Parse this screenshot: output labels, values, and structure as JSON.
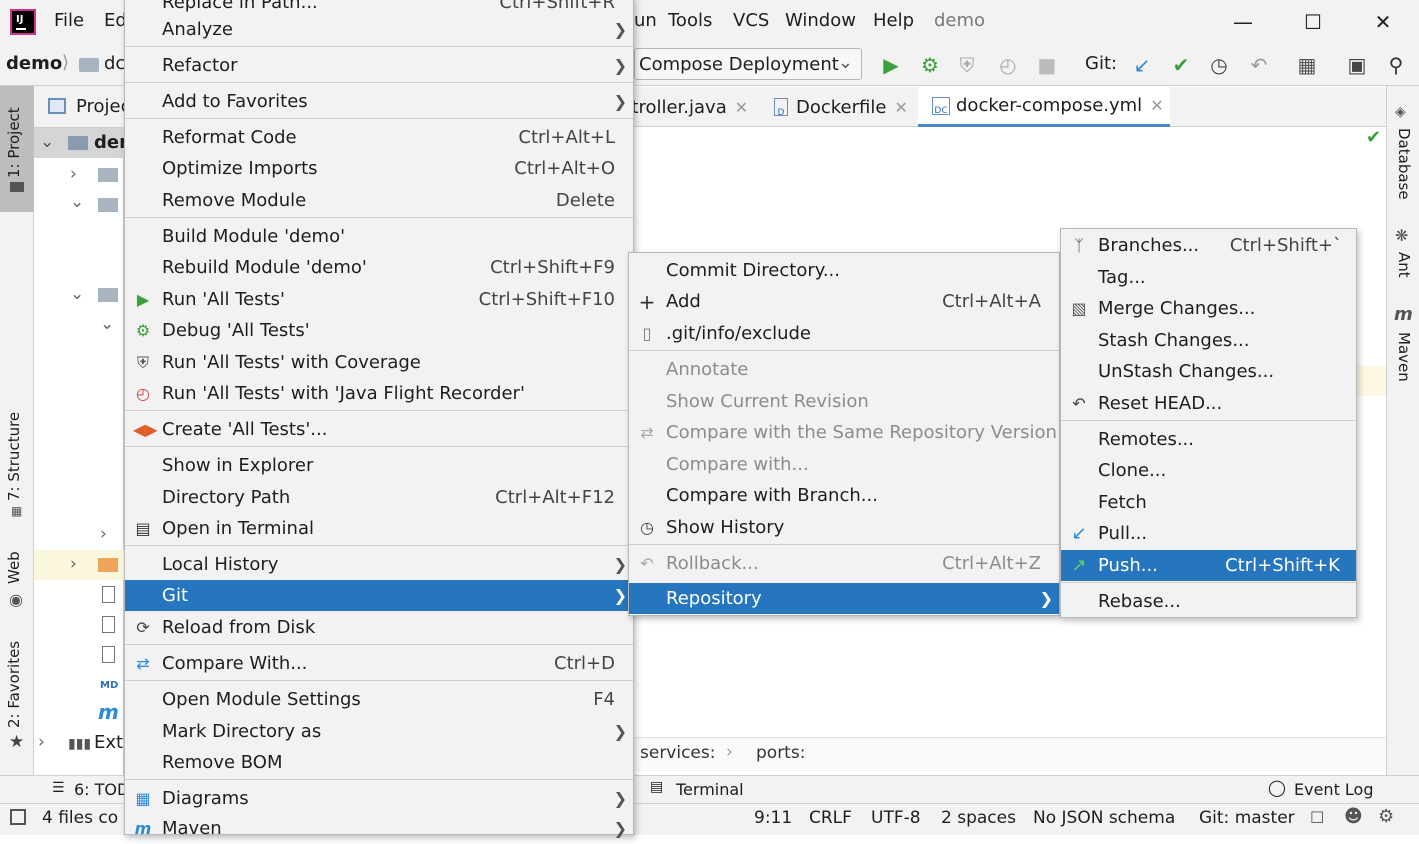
{
  "titlebar": {
    "menus": [
      "File",
      "Ed",
      "un",
      "Tools",
      "VCS",
      "Window",
      "Help"
    ],
    "project_name": "demo"
  },
  "navbar": {
    "crumb_project": "demo",
    "crumb_folder": "dc",
    "run_config": "Compose Deployment",
    "git_label": "Git:"
  },
  "tabs": [
    {
      "label": "ntroller.java"
    },
    {
      "label": "Dockerfile"
    },
    {
      "label": "docker-compose.yml",
      "badge": "DC"
    }
  ],
  "left_stripe": [
    "1: Project",
    "7: Structure",
    "Web",
    "2: Favorites"
  ],
  "right_stripe": [
    "Database",
    "Ant",
    "Maven"
  ],
  "project_panel": {
    "header": "Projec",
    "root": "der",
    "ext": "Exte"
  },
  "editor_breadcrumb": {
    "a": "services:",
    "b": "ports:"
  },
  "bottombar": {
    "todo": "6: TOD",
    "terminal": "Terminal",
    "event_log": "Event Log"
  },
  "statusbar": {
    "left": "4 files co",
    "position": "9:11",
    "line_sep": "CRLF",
    "encoding": "UTF-8",
    "indent": "2 spaces",
    "schema": "No JSON schema",
    "git": "Git: master"
  },
  "context_menu": {
    "top_partial": "Replace in Path...",
    "top_partial_shortcut": "Ctrl+Shift+R",
    "items": [
      {
        "label": "Analyze"
      },
      {
        "label": "Refactor"
      },
      {
        "label": "Add to Favorites"
      },
      {
        "label": "Reformat Code",
        "shortcut": "Ctrl+Alt+L"
      },
      {
        "label": "Optimize Imports",
        "shortcut": "Ctrl+Alt+O"
      },
      {
        "label": "Remove Module",
        "shortcut": "Delete"
      },
      {
        "label": "Build Module 'demo'"
      },
      {
        "label": "Rebuild Module 'demo'",
        "shortcut": "Ctrl+Shift+F9"
      },
      {
        "label": "Run 'All Tests'",
        "shortcut": "Ctrl+Shift+F10"
      },
      {
        "label": "Debug 'All Tests'"
      },
      {
        "label": "Run 'All Tests' with Coverage"
      },
      {
        "label": "Run 'All Tests' with 'Java Flight Recorder'"
      },
      {
        "label": "Create 'All Tests'..."
      },
      {
        "label": "Show in Explorer"
      },
      {
        "label": "Directory Path",
        "shortcut": "Ctrl+Alt+F12"
      },
      {
        "label": "Open in Terminal"
      },
      {
        "label": "Local History"
      },
      {
        "label": "Git"
      },
      {
        "label": "Reload from Disk"
      },
      {
        "label": "Compare With...",
        "shortcut": "Ctrl+D"
      },
      {
        "label": "Open Module Settings",
        "shortcut": "F4"
      },
      {
        "label": "Mark Directory as"
      },
      {
        "label": "Remove BOM"
      },
      {
        "label": "Diagrams"
      },
      {
        "label": "Maven"
      }
    ]
  },
  "git_menu": {
    "items": [
      {
        "label": "Commit Directory..."
      },
      {
        "label": "Add",
        "shortcut": "Ctrl+Alt+A"
      },
      {
        "label": ".git/info/exclude"
      },
      {
        "label": "Annotate"
      },
      {
        "label": "Show Current Revision"
      },
      {
        "label": "Compare with the Same Repository Version"
      },
      {
        "label": "Compare with..."
      },
      {
        "label": "Compare with Branch..."
      },
      {
        "label": "Show History"
      },
      {
        "label": "Rollback...",
        "shortcut": "Ctrl+Alt+Z"
      },
      {
        "label": "Repository"
      }
    ]
  },
  "repo_menu": {
    "items": [
      {
        "label": "Branches...",
        "shortcut": "Ctrl+Shift+`"
      },
      {
        "label": "Tag..."
      },
      {
        "label": "Merge Changes..."
      },
      {
        "label": "Stash Changes..."
      },
      {
        "label": "UnStash Changes..."
      },
      {
        "label": "Reset HEAD..."
      },
      {
        "label": "Remotes..."
      },
      {
        "label": "Clone..."
      },
      {
        "label": "Fetch"
      },
      {
        "label": "Pull..."
      },
      {
        "label": "Push...",
        "shortcut": "Ctrl+Shift+K"
      },
      {
        "label": "Rebase..."
      }
    ]
  },
  "colors": {
    "selection": "#2675bf",
    "run_green": "#3aa13a",
    "vcs_blue": "#2d8ad8"
  }
}
